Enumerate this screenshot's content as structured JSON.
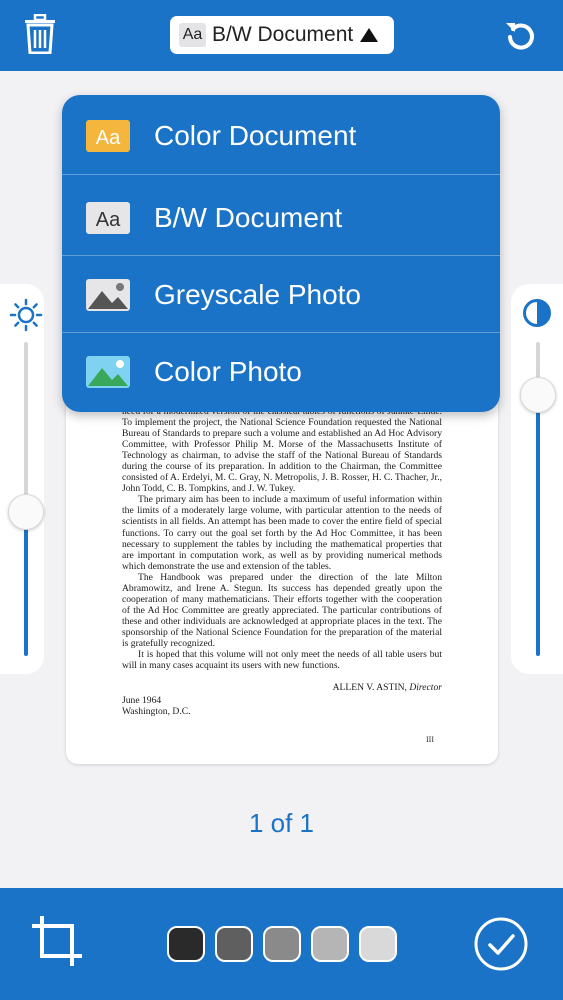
{
  "header": {
    "mode_icon_text": "Aa",
    "mode_label": "B/W Document"
  },
  "dropdown": {
    "items": [
      {
        "label": "Color Document",
        "icon": "color-document-icon",
        "icon_text": "Aa"
      },
      {
        "label": "B/W Document",
        "icon": "bw-document-icon",
        "icon_text": "Aa"
      },
      {
        "label": "Greyscale Photo",
        "icon": "greyscale-photo-icon"
      },
      {
        "label": "Color Photo",
        "icon": "color-photo-icon"
      }
    ]
  },
  "document": {
    "paragraphs": [
      "need for a modernized version of the classical tables of functions of Jahnke-Emde. To implement the project, the National Science Foundation requested the National Bureau of Standards to prepare such a volume and established an Ad Hoc Advisory Committee, with Professor Philip M. Morse of the Massachusetts Institute of Technology as chairman, to advise the staff of the National Bureau of Standards during the course of its preparation. In addition to the Chairman, the Committee consisted of A. Erdelyi, M. C. Gray, N. Metropolis, J. B. Rosser, H. C. Thacher, Jr., John Todd, C. B. Tompkins, and J. W. Tukey.",
      "The primary aim has been to include a maximum of useful information within the limits of a moderately large volume, with particular attention to the needs of scientists in all fields. An attempt has been made to cover the entire field of special functions. To carry out the goal set forth by the Ad Hoc Committee, it has been necessary to supplement the tables by including the mathematical properties that are important in computation work, as well as by providing numerical methods which demonstrate the use and extension of the tables.",
      "The Handbook was prepared under the direction of the late Milton Abramowitz, and Irene A. Stegun. Its success has depended greatly upon the cooperation of many mathematicians. Their efforts together with the cooperation of the Ad Hoc Committee are greatly appreciated. The particular contributions of these and other individuals are acknowledged at appropriate places in the text. The sponsorship of the National Science Foundation for the preparation of the material is gratefully recognized.",
      "It is hoped that this volume will not only meet the needs of all table users but will in many cases acquaint its users with new functions."
    ],
    "signature_name": "ALLEN V. ASTIN,",
    "signature_title": "Director",
    "date": "June 1964",
    "place": "Washington, D.C.",
    "page_number": "III"
  },
  "page_counter": "1 of 1",
  "sliders": {
    "brightness_level": 0.46,
    "contrast_level": 0.83
  },
  "swatches": [
    "#2a2a2a",
    "#5f5f5f",
    "#8a8a8a",
    "#b5b5b5",
    "#d9d9d9"
  ],
  "colors": {
    "accent": "#1a73c6",
    "background": "#f2f2f4",
    "color_doc_icon": "#f4b63d"
  }
}
